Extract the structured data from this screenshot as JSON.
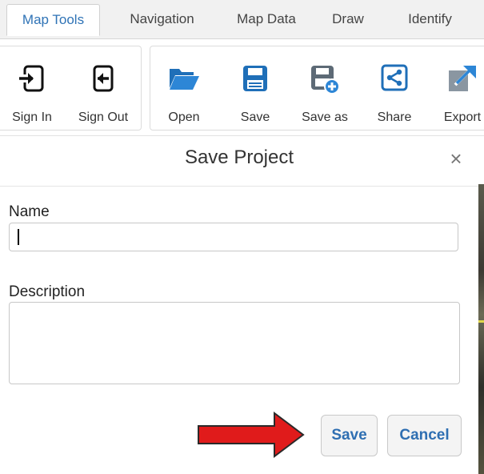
{
  "tabs": [
    {
      "label": "Map Tools",
      "active": true
    },
    {
      "label": "Navigation",
      "active": false
    },
    {
      "label": "Map Data",
      "active": false
    },
    {
      "label": "Draw",
      "active": false
    },
    {
      "label": "Identify",
      "active": false
    }
  ],
  "ribbon": {
    "account": [
      {
        "label": "Sign In",
        "icon": "sign-in-icon"
      },
      {
        "label": "Sign Out",
        "icon": "sign-out-icon"
      }
    ],
    "project": [
      {
        "label": "Open",
        "icon": "folder-open-icon"
      },
      {
        "label": "Save",
        "icon": "floppy-disk-icon"
      },
      {
        "label": "Save as",
        "icon": "save-as-icon"
      },
      {
        "label": "Share",
        "icon": "share-icon"
      },
      {
        "label": "Export",
        "icon": "export-icon"
      }
    ]
  },
  "dialog": {
    "title": "Save Project",
    "close_glyph": "×",
    "name_label": "Name",
    "name_value": "",
    "description_label": "Description",
    "description_value": "",
    "save_label": "Save",
    "cancel_label": "Cancel"
  },
  "colors": {
    "accent": "#2f73b6",
    "icon_blue": "#1f6fb8",
    "annotation_arrow": "#e01b1b"
  }
}
